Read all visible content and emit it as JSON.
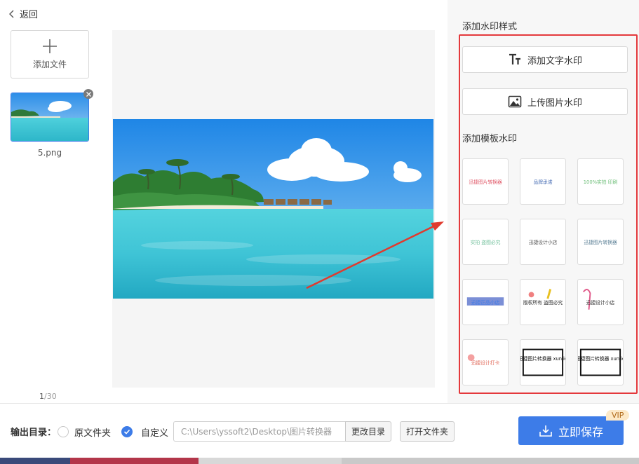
{
  "nav": {
    "back_label": "返回"
  },
  "sidebar": {
    "add_file_label": "添加文件",
    "file_name": "5.png",
    "page_current": "1",
    "page_total": "/30"
  },
  "panel": {
    "style_title": "添加水印样式",
    "text_watermark_label": "添加文字水印",
    "image_watermark_label": "上传图片水印",
    "template_title": "添加模板水印",
    "templates": [
      "迅捷图片转换器",
      "品牌承诺",
      "100%实拍 印刷",
      "实拍 盗图必究",
      "迅捷设计小店",
      "迅捷图片转换器",
      "迅捷正品小店",
      "版权所有 盗图必究",
      "迅捷设计小店",
      "迅捷设计打卡",
      "迅捷图片转换器 xunjie",
      "迅捷图片转换器 xunjie"
    ]
  },
  "bottom": {
    "output_label": "输出目录：",
    "option_original": "原文件夹",
    "option_custom": "自定义",
    "path_value": "C:\\Users\\yssoft2\\Desktop\\图片转换器",
    "change_dir_label": "更改目录",
    "open_folder_label": "打开文件夹",
    "save_label": "立即保存",
    "vip_badge": "VIP"
  },
  "colors": {
    "accent": "#3d7ce8",
    "highlight_box": "#e4393c",
    "arrow": "#e03a2e"
  }
}
